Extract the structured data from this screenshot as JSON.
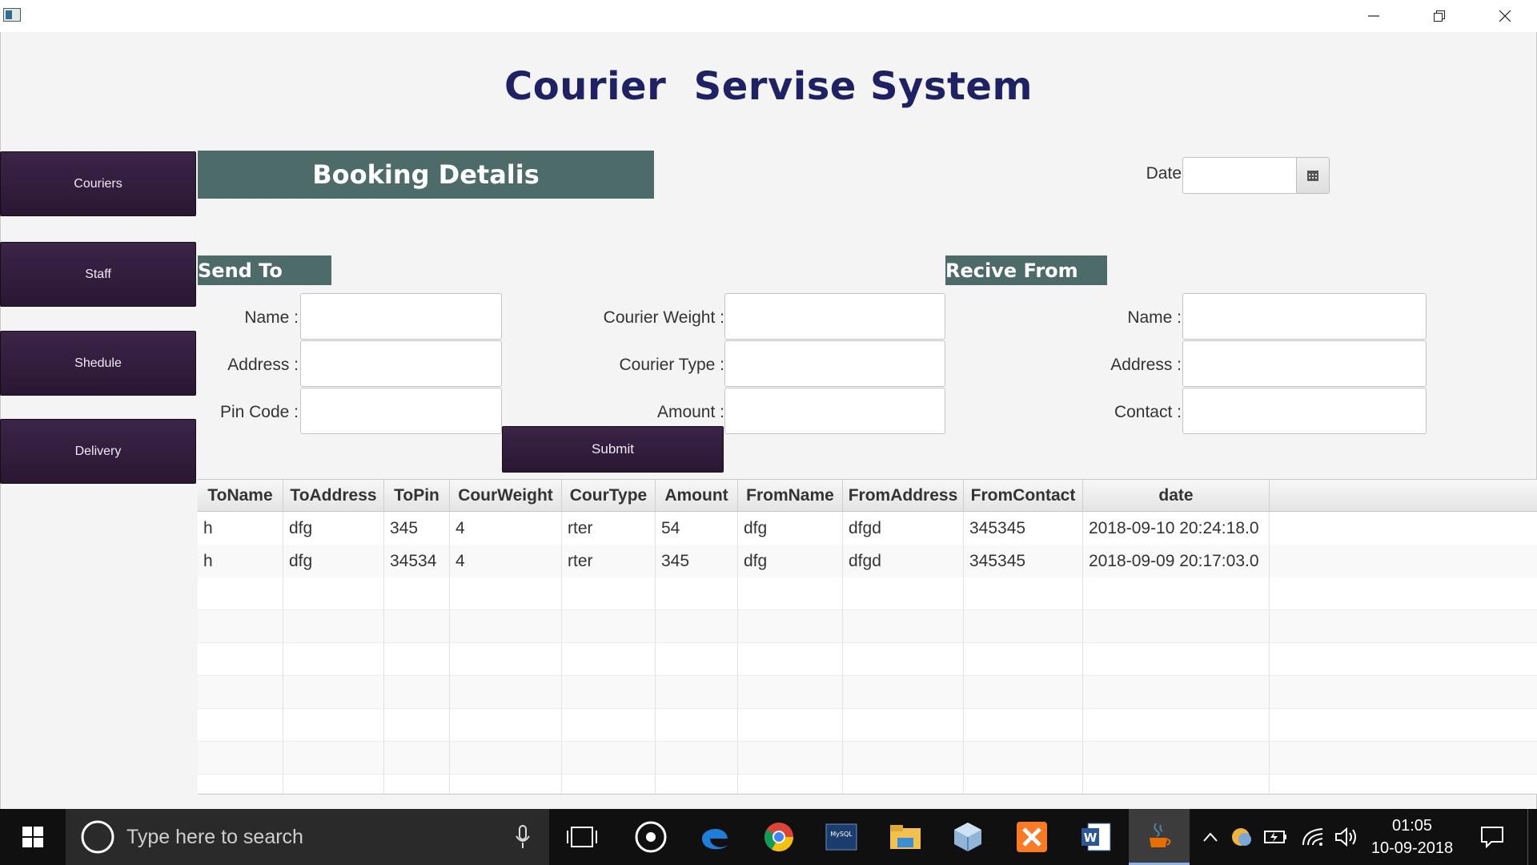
{
  "window": {
    "minimize_icon": "minimize-icon",
    "restore_icon": "restore-icon",
    "close_icon": "close-icon"
  },
  "app_title": "Courier  Servise System",
  "sidebar": {
    "items": [
      {
        "label": "Couriers"
      },
      {
        "label": "Staff"
      },
      {
        "label": "Shedule"
      },
      {
        "label": "Delivery"
      }
    ]
  },
  "booking_header": "Booking Detalis",
  "date": {
    "label": "Date",
    "value": "",
    "picker_icon": "calendar-icon"
  },
  "send_to": {
    "header": "Send To",
    "name_label": "Name :",
    "address_label": "Address :",
    "pin_label": "Pin Code :"
  },
  "courier": {
    "weight_label": "Courier Weight :",
    "type_label": "Courier Type :",
    "amount_label": "Amount :"
  },
  "receive_from": {
    "header": "Recive From",
    "name_label": "Name :",
    "address_label": "Address :",
    "contact_label": "Contact :"
  },
  "submit_label": "Submit",
  "table": {
    "columns": [
      "ToName",
      "ToAddress",
      "ToPin",
      "CourWeight",
      "CourType",
      "Amount",
      "FromName",
      "FromAddress",
      "FromContact",
      "date"
    ],
    "rows": [
      [
        "h",
        "dfg",
        "345",
        "4",
        "rter",
        "54",
        "dfg",
        "dfgd",
        "345345",
        "2018-09-10 20:24:18.0"
      ],
      [
        "h",
        "dfg",
        "34534",
        "4",
        "rter",
        "345",
        "dfg",
        "dfgd",
        "345345",
        "2018-09-09 20:17:03.0"
      ]
    ]
  },
  "taskbar": {
    "search_placeholder": "Type here to search",
    "time": "01:05",
    "date": "10-09-2018"
  },
  "colors": {
    "title": "#1e2264",
    "nav_button": "#2f1b3a",
    "section_header": "#4d6b68"
  }
}
